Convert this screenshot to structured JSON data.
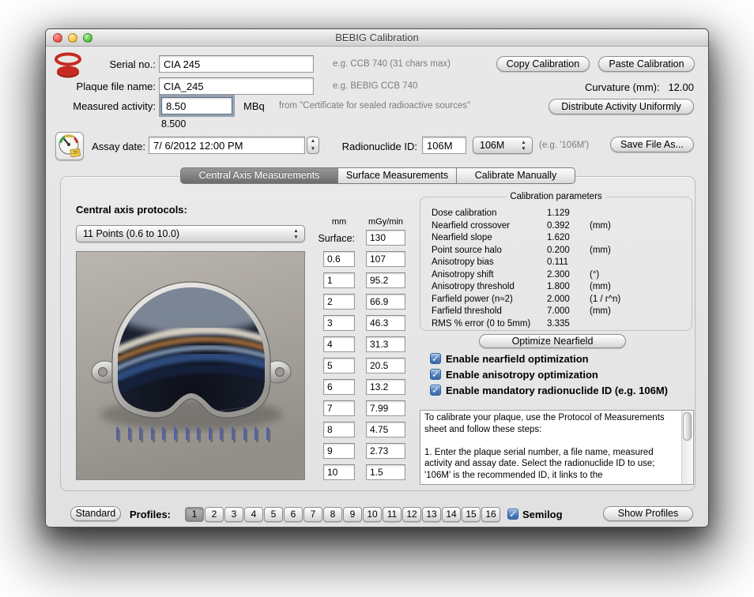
{
  "window": {
    "title": "BEBIG Calibration"
  },
  "header": {
    "serial_label": "Serial no.:",
    "serial_value": "CIA 245",
    "serial_hint": "e.g. CCB 740 (31 chars max)",
    "copy_button": "Copy Calibration",
    "paste_button": "Paste Calibration",
    "file_label": "Plaque file name:",
    "file_value": "CIA_245",
    "file_hint": "e.g. BEBIG CCB 740",
    "curvature_label": "Curvature (mm):",
    "curvature_value": "12.00",
    "activity_label": "Measured activity:",
    "activity_value": "8.50",
    "activity_unit": "MBq",
    "activity_hint": "from \"Certificate for sealed radioactive sources\"",
    "activity_converted": "8.500",
    "distribute_button": "Distribute Activity Uniformly",
    "assay_label": "Assay date:",
    "assay_value": "7/ 6/2012 12:00 PM",
    "radionuclide_label": "Radionuclide ID:",
    "radionuclide_value": "106M",
    "radionuclide_popup": "106M",
    "radionuclide_hint": "(e.g. '106M')",
    "save_button": "Save File As..."
  },
  "tabs": [
    {
      "label": "Central Axis Measurements",
      "selected": true
    },
    {
      "label": "Surface Measurements",
      "selected": false
    },
    {
      "label": "Calibrate Manually",
      "selected": false
    }
  ],
  "main": {
    "protocols_label": "Central axis protocols:",
    "protocols_value": "11 Points (0.6 to 10.0)",
    "col_mm": "mm",
    "col_dose": "mGy/min",
    "surface_label": "Surface:",
    "surface_value": "130",
    "rows": [
      {
        "mm": "0.6",
        "dose": "107"
      },
      {
        "mm": "1",
        "dose": "95.2"
      },
      {
        "mm": "2",
        "dose": "66.9"
      },
      {
        "mm": "3",
        "dose": "46.3"
      },
      {
        "mm": "4",
        "dose": "31.3"
      },
      {
        "mm": "5",
        "dose": "20.5"
      },
      {
        "mm": "6",
        "dose": "13.2"
      },
      {
        "mm": "7",
        "dose": "7.99"
      },
      {
        "mm": "8",
        "dose": "4.75"
      },
      {
        "mm": "9",
        "dose": "2.73"
      },
      {
        "mm": "10",
        "dose": "1.5"
      }
    ],
    "params": {
      "title": "Calibration parameters",
      "rows": [
        {
          "name": "Dose calibration",
          "value": "1.129",
          "unit": ""
        },
        {
          "name": "Nearfield crossover",
          "value": "0.392",
          "unit": "(mm)"
        },
        {
          "name": "Nearfield slope",
          "value": "1.620",
          "unit": ""
        },
        {
          "name": "Point source halo",
          "value": "0.200",
          "unit": "(mm)"
        },
        {
          "name": "Anisotropy bias",
          "value": "0.111",
          "unit": ""
        },
        {
          "name": "Anisotropy shift",
          "value": "2.300",
          "unit": "(°)"
        },
        {
          "name": "Anisotropy threshold",
          "value": "1.800",
          "unit": "(mm)"
        },
        {
          "name": "Farfield power (n≈2)",
          "value": "2.000",
          "unit": "(1 / r^n)"
        },
        {
          "name": "Farfield threshold",
          "value": "7.000",
          "unit": "(mm)"
        },
        {
          "name": "RMS % error (0 to 5mm)",
          "value": "3.335",
          "unit": ""
        }
      ],
      "optimize_button": "Optimize Nearfield",
      "checkboxes": [
        {
          "label": "Enable nearfield optimization",
          "checked": true
        },
        {
          "label": "Enable anisotropy optimization",
          "checked": true
        },
        {
          "label": "Enable mandatory radionuclide ID (e.g. 106M)",
          "checked": true
        }
      ]
    },
    "instructions": "To calibrate your plaque, use the Protocol of Measurements sheet and follow these steps:\n\n1. Enter the plaque serial number, a file name, measured activity and assay date. Select the radionuclide ID to use; '106M' is the recommended ID, it links to the"
  },
  "footer": {
    "standard_button": "Standard",
    "profiles_label": "Profiles:",
    "profiles": [
      "1",
      "2",
      "3",
      "4",
      "5",
      "6",
      "7",
      "8",
      "9",
      "10",
      "11",
      "12",
      "13",
      "14",
      "15",
      "16"
    ],
    "selected_profile": "1",
    "semilog_label": "Semilog",
    "semilog_checked": true,
    "show_profiles_button": "Show Profiles"
  },
  "icons": {
    "arrow_up": "▲",
    "arrow_down": "▼",
    "check": "✓"
  }
}
